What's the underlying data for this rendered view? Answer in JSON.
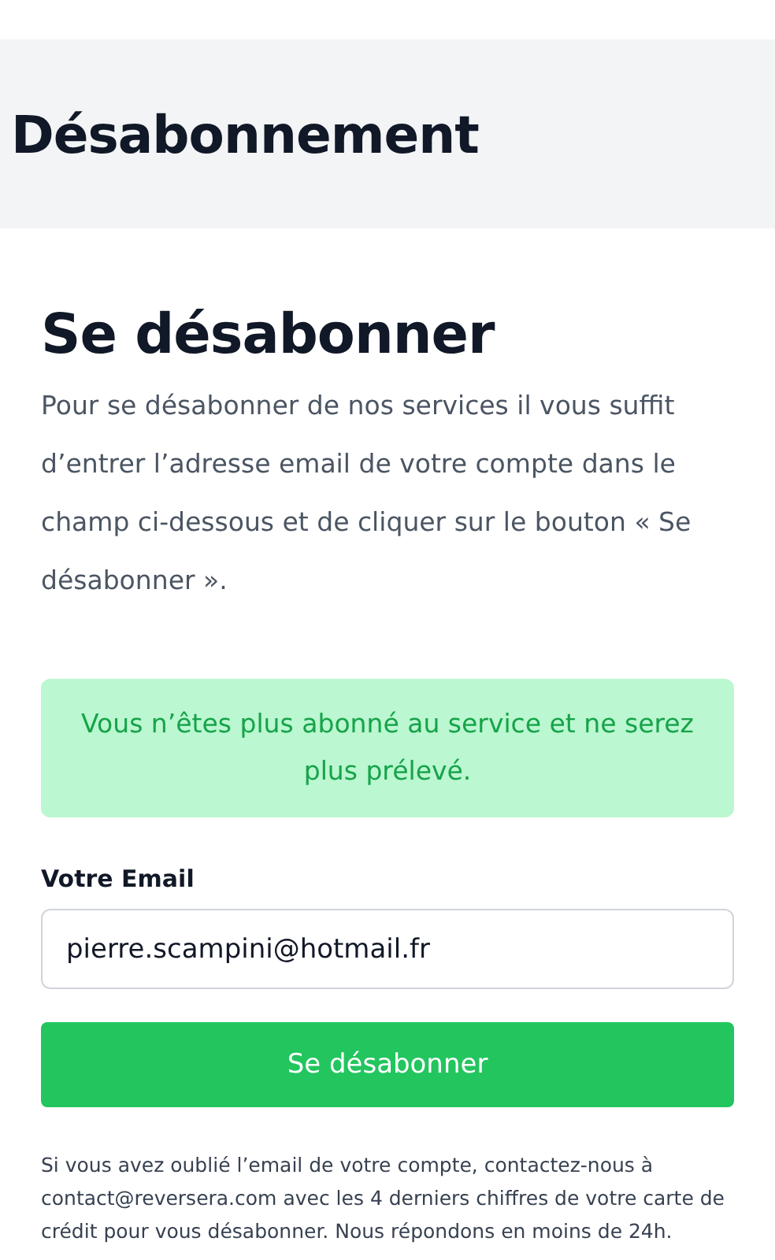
{
  "header": {
    "title": "Désabonnement"
  },
  "section": {
    "title": "Se désabonner",
    "intro": "Pour se désabonner de nos services il vous suffit d’entrer l’adresse email de votre compte dans le champ ci-dessous et de cliquer sur le bouton « Se désabonner »."
  },
  "alert": {
    "kind": "success",
    "message": "Vous n’êtes plus abonné au service et ne serez plus prélevé."
  },
  "email_field": {
    "label": "Votre Email",
    "value": "pierre.scampini@hotmail.fr"
  },
  "submit_button": "Se désabonner",
  "help_text": "Si vous avez oublié l’email de votre compte, contactez-nous à contact@reversera.com avec les 4 derniers chiffres de votre carte de crédit pour vous désabonner. Nous répondons en moins de 24h."
}
